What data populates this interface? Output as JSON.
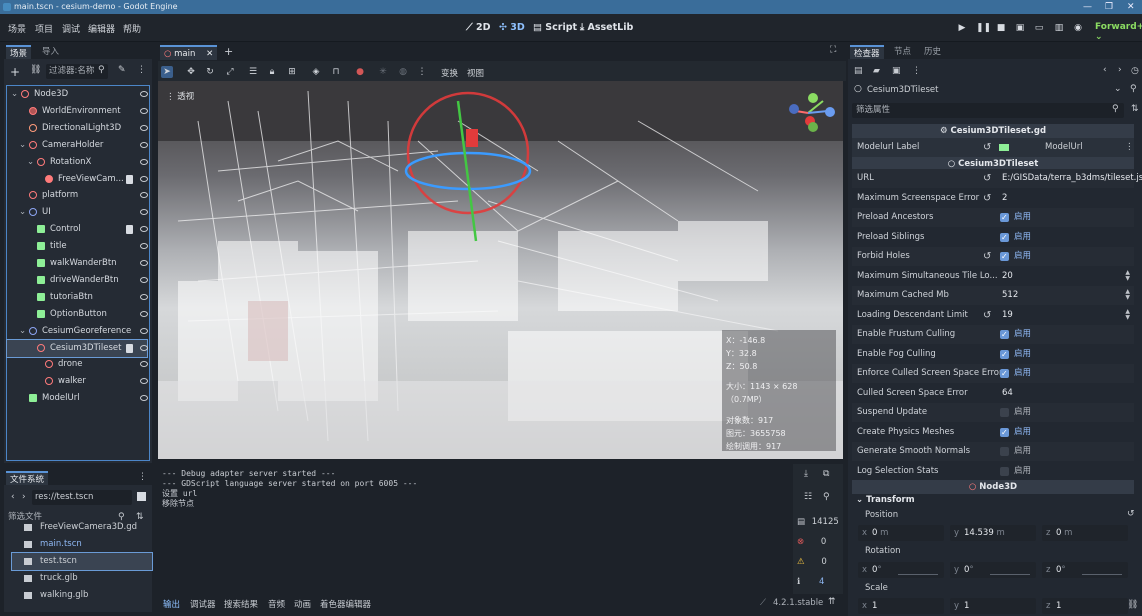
{
  "window": {
    "title": "main.tscn - cesium-demo - Godot Engine"
  },
  "menu": [
    "场景",
    "项目",
    "调试",
    "编辑器",
    "帮助"
  ],
  "workspaces": [
    "2D",
    "3D",
    "Script",
    "AssetLib"
  ],
  "renderer": "Forward+",
  "scene_dock": {
    "tabs": [
      "场景",
      "导入"
    ],
    "filter_placeholder": "过滤器:名称",
    "nodes": [
      {
        "label": "Node3D",
        "depth": 0,
        "arrow": "v"
      },
      {
        "label": "WorldEnvironment",
        "depth": 1
      },
      {
        "label": "DirectionalLight3D",
        "depth": 1
      },
      {
        "label": "CameraHolder",
        "depth": 1,
        "arrow": "v"
      },
      {
        "label": "RotationX",
        "depth": 2,
        "arrow": "v"
      },
      {
        "label": "FreeViewCam...",
        "depth": 3
      },
      {
        "label": "platform",
        "depth": 1
      },
      {
        "label": "UI",
        "depth": 1,
        "arrow": "v"
      },
      {
        "label": "Control",
        "depth": 2
      },
      {
        "label": "title",
        "depth": 2
      },
      {
        "label": "walkWanderBtn",
        "depth": 2
      },
      {
        "label": "driveWanderBtn",
        "depth": 2
      },
      {
        "label": "tutoriaBtn",
        "depth": 2
      },
      {
        "label": "OptionButton",
        "depth": 2
      },
      {
        "label": "CesiumGeoreference",
        "depth": 1,
        "arrow": "v"
      },
      {
        "label": "Cesium3DTileset",
        "depth": 2
      },
      {
        "label": "drone",
        "depth": 3
      },
      {
        "label": "walker",
        "depth": 3
      },
      {
        "label": "ModelUrl",
        "depth": 1
      }
    ]
  },
  "filesystem": {
    "tab": "文件系统",
    "path": "res://test.tscn",
    "filter_placeholder": "筛选文件",
    "files": [
      "FreeViewCamera3D.gd",
      "main.tscn",
      "test.tscn",
      "truck.glb",
      "walking.glb"
    ]
  },
  "editor_tab": "main",
  "viewport": {
    "perspective_label": "透视",
    "stats": {
      "x": "X：-146.8",
      "y": "Y：32.8",
      "z": "Z：50.8",
      "size": "大小：1143 × 628（0.7MP）",
      "objects": "对象数：917",
      "primitives": "图元：3655758",
      "draw_calls": "绘制调用：917"
    },
    "toolbar_labels": [
      "变换",
      "视图"
    ]
  },
  "output": {
    "lines": [
      "--- Debug adapter server started ---",
      "--- GDScript language server started on port 6005 ---",
      "设置 url",
      "移除节点"
    ],
    "counts": [
      "14125",
      "0",
      "0",
      "4"
    ],
    "tabs": [
      "输出",
      "调试器",
      "搜索结果",
      "音频",
      "动画",
      "着色器编辑器"
    ],
    "version": "4.2.1.stable"
  },
  "inspector": {
    "tabs": [
      "检查器",
      "节点",
      "历史"
    ],
    "object": "Cesium3DTileset",
    "filter_placeholder": "筛选属性",
    "script_header": "Cesium3DTileset.gd",
    "modelurl_label_key": "Modelurl Label",
    "modelurl_label_val": "ModelUrl",
    "section": "Cesium3DTileset",
    "enabled_text": "启用",
    "props": [
      {
        "k": "URL",
        "v": "E:/GISData/terra_b3dms/tileset.js",
        "revert": true
      },
      {
        "k": "Maximum Screenspace Error",
        "v": "2",
        "revert": true
      },
      {
        "k": "Preload Ancestors",
        "check": true
      },
      {
        "k": "Preload Siblings",
        "check": true
      },
      {
        "k": "Forbid Holes",
        "check": true,
        "revert": true
      },
      {
        "k": "Maximum Simultaneous Tile Lo...",
        "v": "20",
        "spin": true
      },
      {
        "k": "Maximum Cached Mb",
        "v": "512",
        "spin": true
      },
      {
        "k": "Loading Descendant Limit",
        "v": "19",
        "spin": true,
        "revert": true
      },
      {
        "k": "Enable Frustum Culling",
        "check": true
      },
      {
        "k": "Enable Fog Culling",
        "check": true
      },
      {
        "k": "Enforce Culled Screen Space Error",
        "check": true
      },
      {
        "k": "Culled Screen Space Error",
        "v": "64"
      },
      {
        "k": "Suspend Update",
        "check": false
      },
      {
        "k": "Create Physics Meshes",
        "check": true
      },
      {
        "k": "Generate Smooth Normals",
        "check": false
      },
      {
        "k": "Log Selection Stats",
        "check": false
      }
    ],
    "node3d_section": "Node3D",
    "transform_label": "Transform",
    "position_label": "Position",
    "position": {
      "x": "0",
      "y": "14.539",
      "z": "0",
      "unit": "m"
    },
    "rotation_label": "Rotation",
    "rotation": {
      "x": "0",
      "y": "0",
      "z": "0",
      "unit": "°"
    },
    "scale_label": "Scale",
    "scale": {
      "x": "1",
      "y": "1",
      "z": "1"
    }
  }
}
